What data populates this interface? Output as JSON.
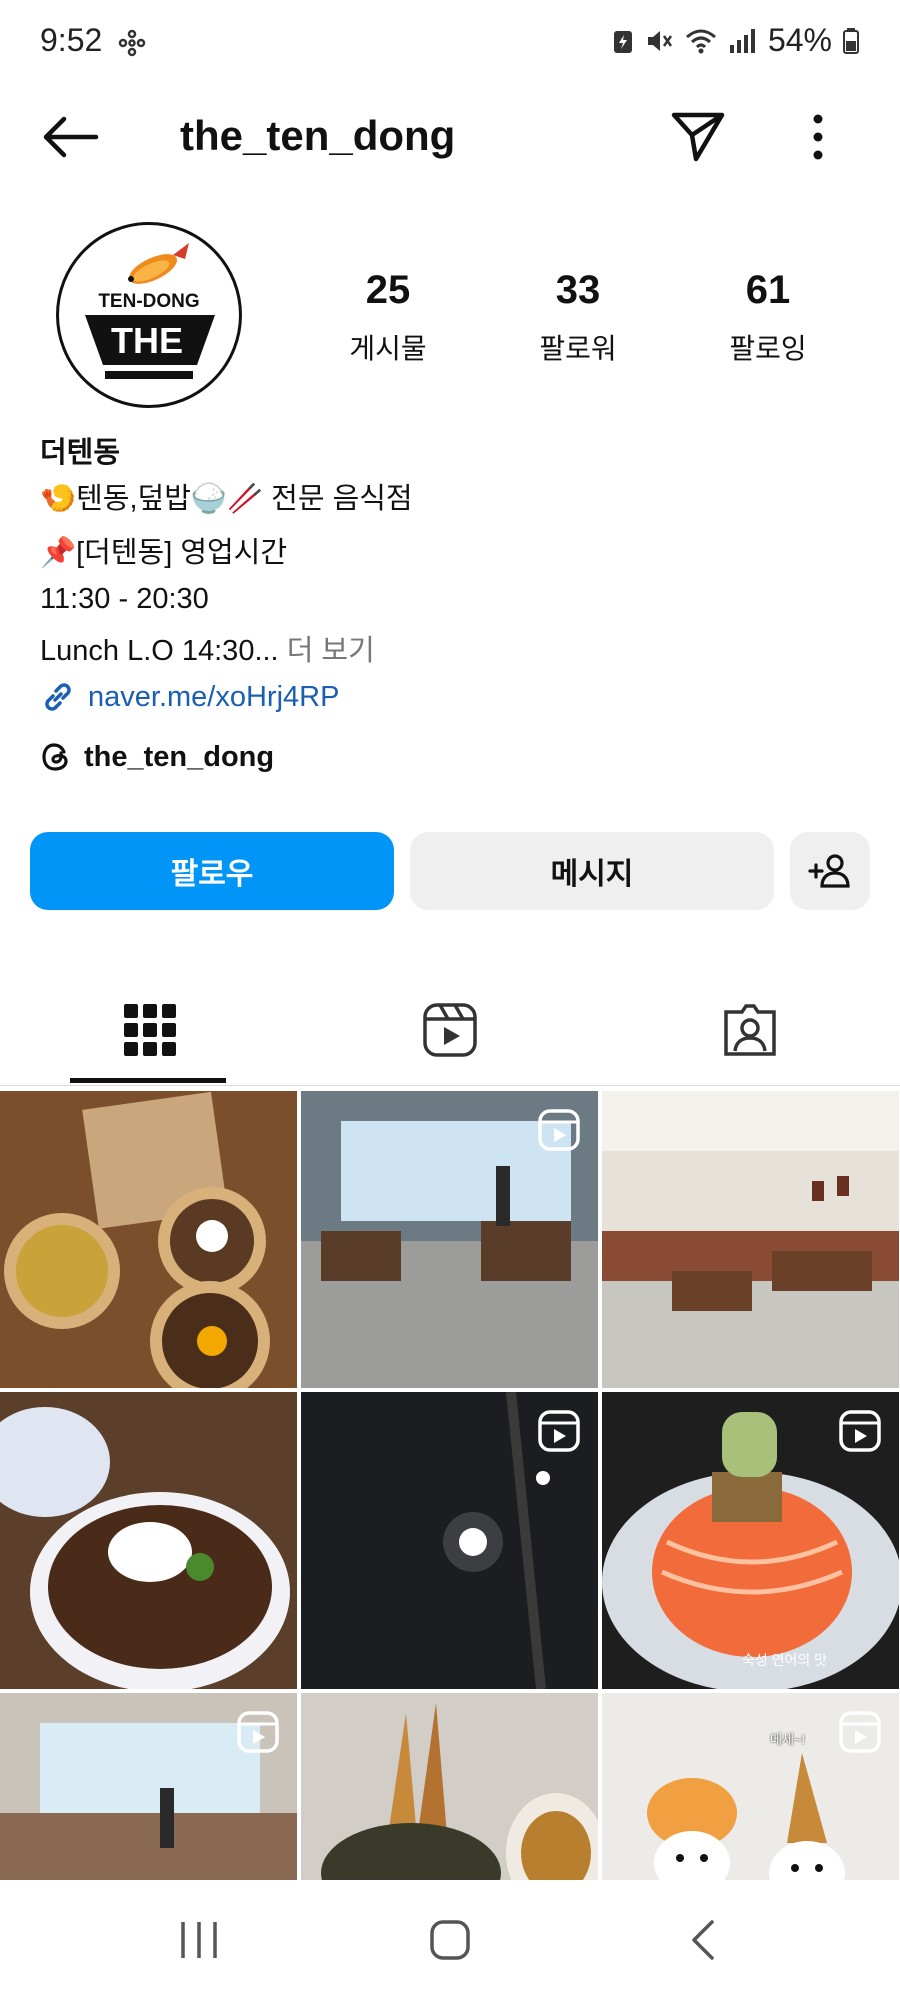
{
  "status_bar": {
    "time": "9:52",
    "battery": "54%"
  },
  "header": {
    "username": "the_ten_dong"
  },
  "profile": {
    "avatar_text_top": "TEN-DONG",
    "avatar_text_main": "THE",
    "stats": [
      {
        "value": "25",
        "label": "게시물"
      },
      {
        "value": "33",
        "label": "팔로워"
      },
      {
        "value": "61",
        "label": "팔로잉"
      }
    ],
    "display_name": "더텐동",
    "bio_line1": "🍤텐동,덮밥🍚🥢 전문 음식점",
    "bio_line2": "📌[더텐동] 영업시간",
    "bio_line3": "11:30 - 20:30",
    "bio_line4": "Lunch L.O 14:30...",
    "more_label": "더 보기",
    "link": "naver.me/xoHrj4RP",
    "threads_handle": "the_ten_dong"
  },
  "buttons": {
    "follow": "팔로우",
    "message": "메시지"
  },
  "grid": {
    "caption_tile6": "숙성 연어의 맛",
    "caption_tile9": "메세~!"
  },
  "colors": {
    "accent": "#0095f6",
    "link": "#1a5fb4"
  }
}
